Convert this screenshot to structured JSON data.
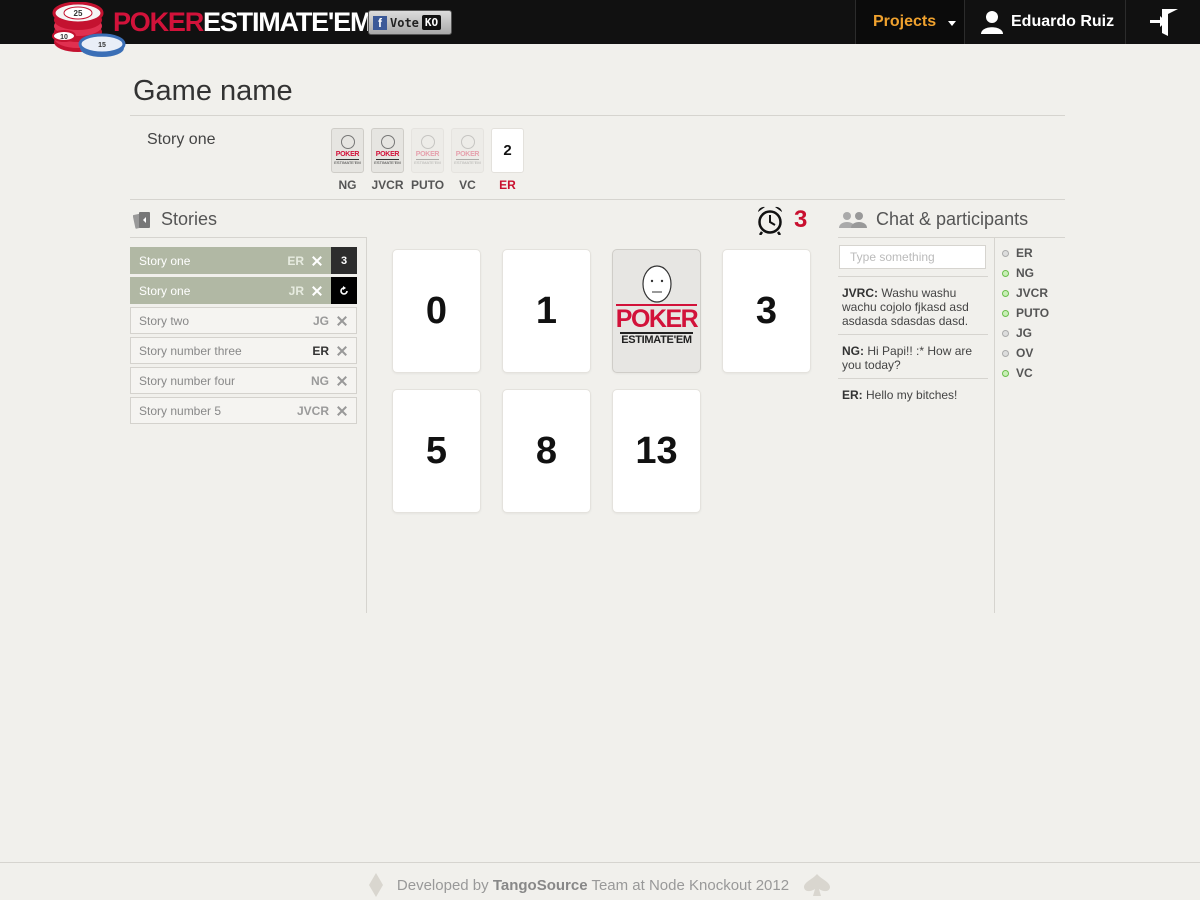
{
  "header": {
    "brand_poker": "POKER",
    "brand_estimate": "ESTIMATE'EM",
    "vote_label": "Vote",
    "vote_ko": "KO",
    "fb_letter": "f",
    "projects_label": "Projects",
    "user_name": "Eduardo Ruiz",
    "chip_values": [
      "25",
      "10",
      "15"
    ]
  },
  "game": {
    "title": "Game name",
    "current_story": "Story one",
    "voters": [
      {
        "initials": "NG",
        "state": "voted"
      },
      {
        "initials": "JVCR",
        "state": "voted"
      },
      {
        "initials": "PUTO",
        "state": "pending"
      },
      {
        "initials": "VC",
        "state": "pending"
      },
      {
        "initials": "ER",
        "state": "value",
        "value": "2"
      }
    ]
  },
  "stories": {
    "heading": "Stories",
    "items": [
      {
        "name": "Story one",
        "owner": "ER",
        "active": true,
        "badge": "3"
      },
      {
        "name": "Story one",
        "owner": "JR",
        "active": true,
        "badge": "refresh"
      },
      {
        "name": "Story two",
        "owner": "JG",
        "active": false
      },
      {
        "name": "Story number three",
        "owner": "ER",
        "active": false
      },
      {
        "name": "Story number four",
        "owner": "NG",
        "active": false
      },
      {
        "name": "Story number 5",
        "owner": "JVCR",
        "active": false
      }
    ]
  },
  "timer": {
    "value": "3"
  },
  "cards": {
    "values": [
      "0",
      "1",
      "POKER",
      "3",
      "5",
      "8",
      "13"
    ],
    "logo_poker": "POKER",
    "logo_estimate": "ESTIMATE'EM"
  },
  "chat": {
    "heading": "Chat & participants",
    "placeholder": "Type something",
    "messages": [
      {
        "author": "JVRC:",
        "text": "Washu washu wachu cojolo fjkasd asd asdasda sdasdas dasd."
      },
      {
        "author": "NG:",
        "text": "Hi Papi!! :* How are you today?"
      },
      {
        "author": "ER:",
        "text": "Hello my bitches!"
      }
    ],
    "participants": [
      {
        "initials": "ER",
        "online": false
      },
      {
        "initials": "NG",
        "online": true
      },
      {
        "initials": "JVCR",
        "online": true
      },
      {
        "initials": "PUTO",
        "online": true
      },
      {
        "initials": "JG",
        "online": false
      },
      {
        "initials": "OV",
        "online": false
      },
      {
        "initials": "VC",
        "online": true
      }
    ]
  },
  "footer": {
    "prefix": "Developed by",
    "team": "TangoSource",
    "suffix": "Team at Node Knockout 2012"
  },
  "colors": {
    "brand_red": "#d2123a",
    "accent_orange": "#f0a22e",
    "active_story": "#b1b8a4",
    "online_green": "#6abf4b"
  }
}
